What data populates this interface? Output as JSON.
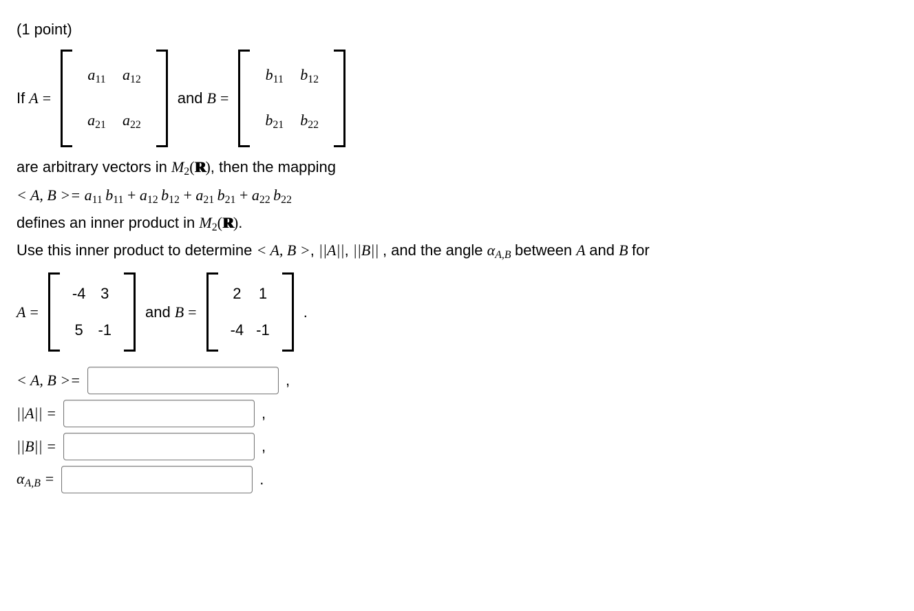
{
  "header": {
    "points_label": "(1 point)"
  },
  "def": {
    "if_label": "If ",
    "and_label": " and ",
    "matrixA_sym": {
      "r1c1": "a",
      "r1c1_sub": "11",
      "r1c2": "a",
      "r1c2_sub": "12",
      "r2c1": "a",
      "r2c1_sub": "21",
      "r2c2": "a",
      "r2c2_sub": "22"
    },
    "matrixB_sym": {
      "r1c1": "b",
      "r1c1_sub": "11",
      "r1c2": "b",
      "r1c2_sub": "12",
      "r2c1": "b",
      "r2c1_sub": "21",
      "r2c2": "b",
      "r2c2_sub": "22"
    }
  },
  "text": {
    "arbitrary_pre": "are arbitrary vectors in ",
    "M2": "M",
    "M2_sub": "2",
    "R_open": "(",
    "R_close": ")",
    "arbitrary_post": ", then the mapping",
    "inner_def_lhs": "< A, B >= ",
    "inner_def_rhs_terms": [
      {
        "a": "a",
        "as": "11",
        "b": "b",
        "bs": "11",
        "op": ""
      },
      {
        "a": "a",
        "as": "12",
        "b": "b",
        "bs": "12",
        "op": " + "
      },
      {
        "a": "a",
        "as": "21",
        "b": "b",
        "bs": "21",
        "op": " + "
      },
      {
        "a": "a",
        "as": "22",
        "b": "b",
        "bs": "22",
        "op": " + "
      }
    ],
    "defines_pre": "defines an inner product in ",
    "defines_post": ".",
    "use_pre": "Use this inner product to determine ",
    "ab_sym": "< A, B >",
    "sep": ", ",
    "normA": "||A||",
    "normB": "||B||",
    "angle_pre": ", and the angle ",
    "alpha": "α",
    "alpha_sub": "A,B",
    "angle_post": " between ",
    "between_and": " and ",
    "for": " for"
  },
  "numeric": {
    "A_label": "A = ",
    "B_label": "B = ",
    "and_label": " and ",
    "period": " .",
    "A": {
      "r1c1": "-4",
      "r1c2": "3",
      "r2c1": "5",
      "r2c2": "-1"
    },
    "B": {
      "r1c1": "2",
      "r1c2": "1",
      "r2c1": "-4",
      "r2c2": "-1"
    }
  },
  "answers": {
    "rows": [
      {
        "label_html": "ab",
        "trail": ","
      },
      {
        "label_html": "normA",
        "trail": ","
      },
      {
        "label_html": "normB",
        "trail": ","
      },
      {
        "label_html": "alpha",
        "trail": "."
      }
    ],
    "ab_label": "< A, B >=",
    "normA_label": "||A|| =",
    "normB_label": "||B|| =",
    "alpha_label_pre": "α",
    "alpha_label_sub": "A,B",
    "alpha_label_post": " ="
  }
}
